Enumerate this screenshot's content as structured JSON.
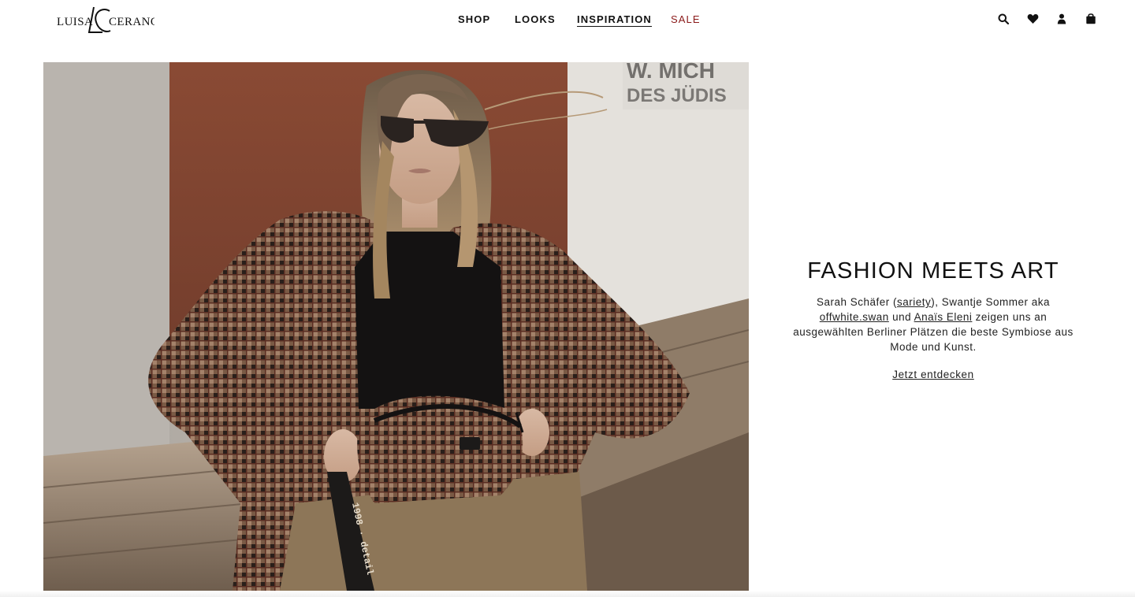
{
  "header": {
    "logo_text_left": "LUISA",
    "logo_text_right": "CERANO",
    "logo_monogram": "LC",
    "nav": [
      {
        "label": "SHOP",
        "active": false
      },
      {
        "label": "LOOKS",
        "active": false
      },
      {
        "label": "INSPIRATION",
        "active": true
      },
      {
        "label": "SALE",
        "active": false,
        "color": "#8b1a1a"
      }
    ],
    "icons": [
      "search-icon",
      "heart-icon",
      "user-icon",
      "bag-icon"
    ]
  },
  "hero": {
    "image": "woman-in-houndstooth-blazer-with-belt-bag",
    "strap_text": "1998 · detail"
  },
  "feature": {
    "title": "FASHION MEETS ART",
    "text_1": "Sarah Schäfer (",
    "link_1": "sariety",
    "text_2": "), Swantje Sommer aka",
    "link_2": "offwhite.swan",
    "text_3": " und ",
    "link_3": "Anaïs Eleni",
    "text_4": " zeigen uns an ausgewählten Berliner Plätzen die beste Symbiose aus Mode und Kunst.",
    "cta": "Jetzt entdecken"
  }
}
